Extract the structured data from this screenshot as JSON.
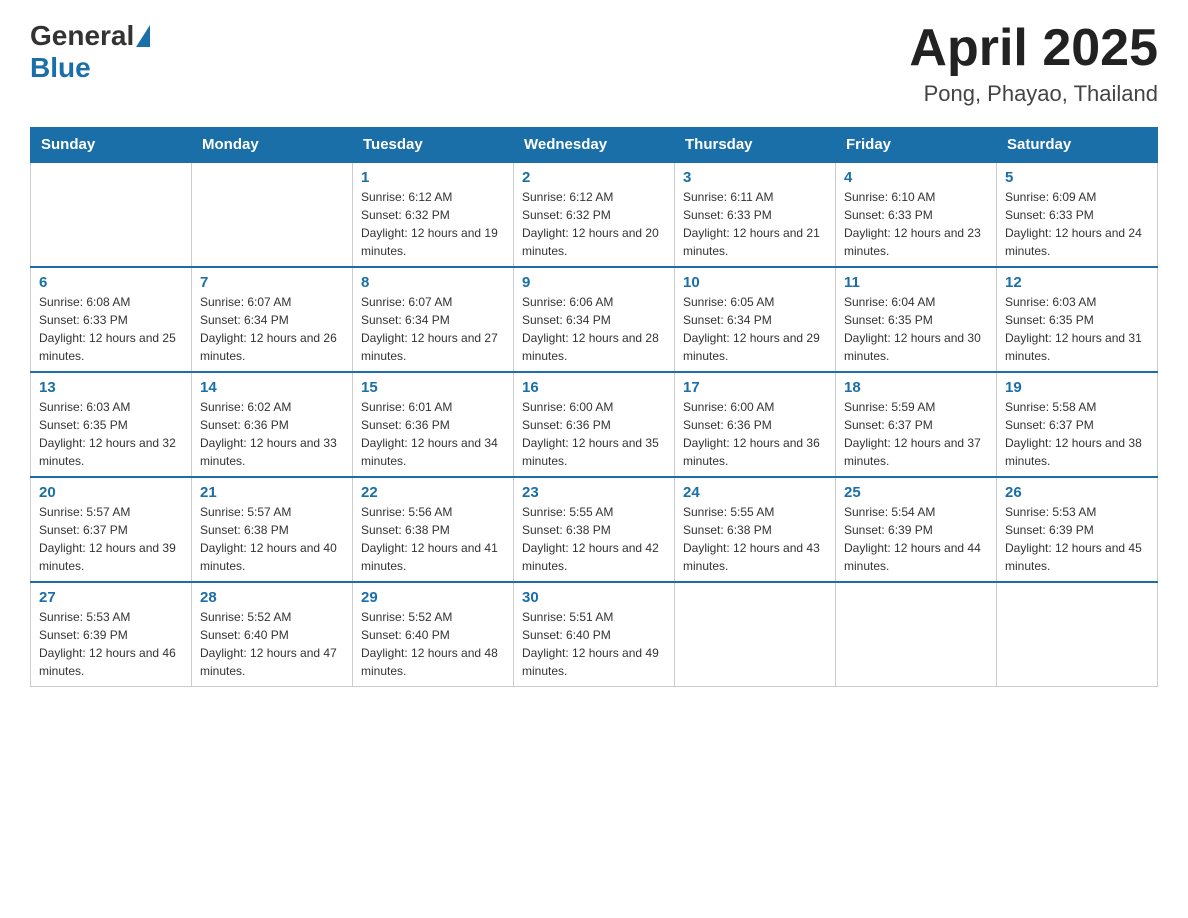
{
  "header": {
    "logo": {
      "general": "General",
      "blue": "Blue"
    },
    "title": "April 2025",
    "location": "Pong, Phayao, Thailand"
  },
  "calendar": {
    "days_of_week": [
      "Sunday",
      "Monday",
      "Tuesday",
      "Wednesday",
      "Thursday",
      "Friday",
      "Saturday"
    ],
    "weeks": [
      [
        {
          "day": "",
          "sunrise": "",
          "sunset": "",
          "daylight": ""
        },
        {
          "day": "",
          "sunrise": "",
          "sunset": "",
          "daylight": ""
        },
        {
          "day": "1",
          "sunrise": "Sunrise: 6:12 AM",
          "sunset": "Sunset: 6:32 PM",
          "daylight": "Daylight: 12 hours and 19 minutes."
        },
        {
          "day": "2",
          "sunrise": "Sunrise: 6:12 AM",
          "sunset": "Sunset: 6:32 PM",
          "daylight": "Daylight: 12 hours and 20 minutes."
        },
        {
          "day": "3",
          "sunrise": "Sunrise: 6:11 AM",
          "sunset": "Sunset: 6:33 PM",
          "daylight": "Daylight: 12 hours and 21 minutes."
        },
        {
          "day": "4",
          "sunrise": "Sunrise: 6:10 AM",
          "sunset": "Sunset: 6:33 PM",
          "daylight": "Daylight: 12 hours and 23 minutes."
        },
        {
          "day": "5",
          "sunrise": "Sunrise: 6:09 AM",
          "sunset": "Sunset: 6:33 PM",
          "daylight": "Daylight: 12 hours and 24 minutes."
        }
      ],
      [
        {
          "day": "6",
          "sunrise": "Sunrise: 6:08 AM",
          "sunset": "Sunset: 6:33 PM",
          "daylight": "Daylight: 12 hours and 25 minutes."
        },
        {
          "day": "7",
          "sunrise": "Sunrise: 6:07 AM",
          "sunset": "Sunset: 6:34 PM",
          "daylight": "Daylight: 12 hours and 26 minutes."
        },
        {
          "day": "8",
          "sunrise": "Sunrise: 6:07 AM",
          "sunset": "Sunset: 6:34 PM",
          "daylight": "Daylight: 12 hours and 27 minutes."
        },
        {
          "day": "9",
          "sunrise": "Sunrise: 6:06 AM",
          "sunset": "Sunset: 6:34 PM",
          "daylight": "Daylight: 12 hours and 28 minutes."
        },
        {
          "day": "10",
          "sunrise": "Sunrise: 6:05 AM",
          "sunset": "Sunset: 6:34 PM",
          "daylight": "Daylight: 12 hours and 29 minutes."
        },
        {
          "day": "11",
          "sunrise": "Sunrise: 6:04 AM",
          "sunset": "Sunset: 6:35 PM",
          "daylight": "Daylight: 12 hours and 30 minutes."
        },
        {
          "day": "12",
          "sunrise": "Sunrise: 6:03 AM",
          "sunset": "Sunset: 6:35 PM",
          "daylight": "Daylight: 12 hours and 31 minutes."
        }
      ],
      [
        {
          "day": "13",
          "sunrise": "Sunrise: 6:03 AM",
          "sunset": "Sunset: 6:35 PM",
          "daylight": "Daylight: 12 hours and 32 minutes."
        },
        {
          "day": "14",
          "sunrise": "Sunrise: 6:02 AM",
          "sunset": "Sunset: 6:36 PM",
          "daylight": "Daylight: 12 hours and 33 minutes."
        },
        {
          "day": "15",
          "sunrise": "Sunrise: 6:01 AM",
          "sunset": "Sunset: 6:36 PM",
          "daylight": "Daylight: 12 hours and 34 minutes."
        },
        {
          "day": "16",
          "sunrise": "Sunrise: 6:00 AM",
          "sunset": "Sunset: 6:36 PM",
          "daylight": "Daylight: 12 hours and 35 minutes."
        },
        {
          "day": "17",
          "sunrise": "Sunrise: 6:00 AM",
          "sunset": "Sunset: 6:36 PM",
          "daylight": "Daylight: 12 hours and 36 minutes."
        },
        {
          "day": "18",
          "sunrise": "Sunrise: 5:59 AM",
          "sunset": "Sunset: 6:37 PM",
          "daylight": "Daylight: 12 hours and 37 minutes."
        },
        {
          "day": "19",
          "sunrise": "Sunrise: 5:58 AM",
          "sunset": "Sunset: 6:37 PM",
          "daylight": "Daylight: 12 hours and 38 minutes."
        }
      ],
      [
        {
          "day": "20",
          "sunrise": "Sunrise: 5:57 AM",
          "sunset": "Sunset: 6:37 PM",
          "daylight": "Daylight: 12 hours and 39 minutes."
        },
        {
          "day": "21",
          "sunrise": "Sunrise: 5:57 AM",
          "sunset": "Sunset: 6:38 PM",
          "daylight": "Daylight: 12 hours and 40 minutes."
        },
        {
          "day": "22",
          "sunrise": "Sunrise: 5:56 AM",
          "sunset": "Sunset: 6:38 PM",
          "daylight": "Daylight: 12 hours and 41 minutes."
        },
        {
          "day": "23",
          "sunrise": "Sunrise: 5:55 AM",
          "sunset": "Sunset: 6:38 PM",
          "daylight": "Daylight: 12 hours and 42 minutes."
        },
        {
          "day": "24",
          "sunrise": "Sunrise: 5:55 AM",
          "sunset": "Sunset: 6:38 PM",
          "daylight": "Daylight: 12 hours and 43 minutes."
        },
        {
          "day": "25",
          "sunrise": "Sunrise: 5:54 AM",
          "sunset": "Sunset: 6:39 PM",
          "daylight": "Daylight: 12 hours and 44 minutes."
        },
        {
          "day": "26",
          "sunrise": "Sunrise: 5:53 AM",
          "sunset": "Sunset: 6:39 PM",
          "daylight": "Daylight: 12 hours and 45 minutes."
        }
      ],
      [
        {
          "day": "27",
          "sunrise": "Sunrise: 5:53 AM",
          "sunset": "Sunset: 6:39 PM",
          "daylight": "Daylight: 12 hours and 46 minutes."
        },
        {
          "day": "28",
          "sunrise": "Sunrise: 5:52 AM",
          "sunset": "Sunset: 6:40 PM",
          "daylight": "Daylight: 12 hours and 47 minutes."
        },
        {
          "day": "29",
          "sunrise": "Sunrise: 5:52 AM",
          "sunset": "Sunset: 6:40 PM",
          "daylight": "Daylight: 12 hours and 48 minutes."
        },
        {
          "day": "30",
          "sunrise": "Sunrise: 5:51 AM",
          "sunset": "Sunset: 6:40 PM",
          "daylight": "Daylight: 12 hours and 49 minutes."
        },
        {
          "day": "",
          "sunrise": "",
          "sunset": "",
          "daylight": ""
        },
        {
          "day": "",
          "sunrise": "",
          "sunset": "",
          "daylight": ""
        },
        {
          "day": "",
          "sunrise": "",
          "sunset": "",
          "daylight": ""
        }
      ]
    ]
  }
}
